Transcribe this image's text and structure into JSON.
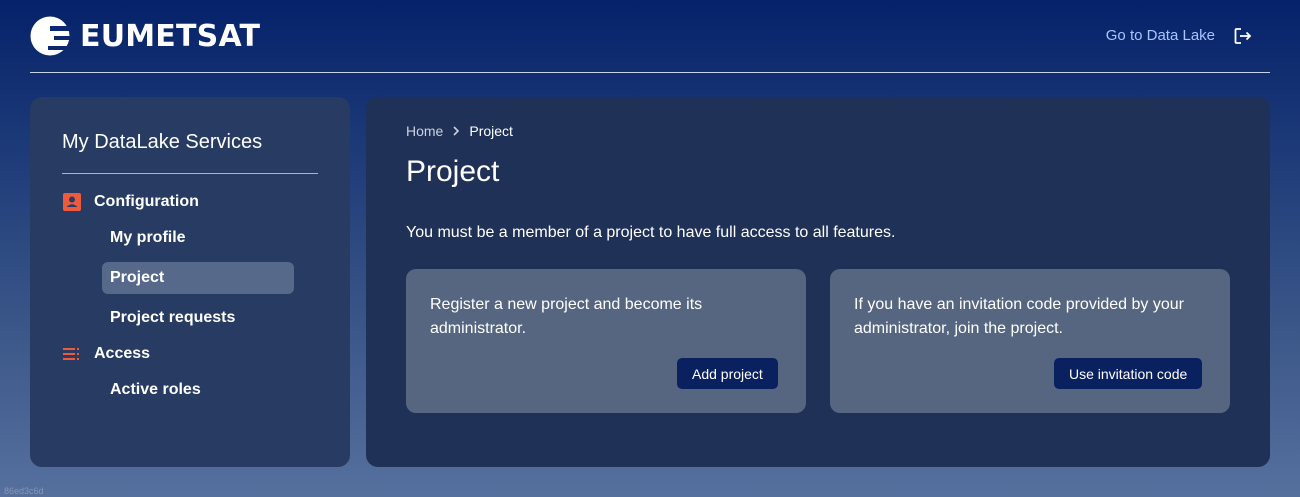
{
  "header": {
    "logo_text": "EUMETSAT",
    "data_lake_link": "Go to Data Lake",
    "logout_icon": "logout-icon"
  },
  "sidebar": {
    "title": "My DataLake Services",
    "sections": [
      {
        "label": "Configuration",
        "icon": "account-box-icon",
        "icon_color": "#f05a3c",
        "items": [
          {
            "label": "My profile",
            "active": false
          },
          {
            "label": "Project",
            "active": true
          },
          {
            "label": "Project requests",
            "active": false
          }
        ]
      },
      {
        "label": "Access",
        "icon": "list-icon",
        "icon_color": "#f05a3c",
        "items": [
          {
            "label": "Active roles",
            "active": false
          }
        ]
      }
    ]
  },
  "main": {
    "breadcrumb": {
      "home": "Home",
      "current": "Project"
    },
    "title": "Project",
    "intro": "You must be a member of a project to have full access to all features.",
    "cards": [
      {
        "text": "Register a new project and become its administrator.",
        "button": "Add project"
      },
      {
        "text": "If you have an invitation code provided by your administrator, join the project.",
        "button": "Use invitation code"
      }
    ]
  },
  "footer": {
    "version": "86ed3c6d"
  },
  "colors": {
    "accent": "#f05a3c",
    "button": "#0a2160",
    "link": "#a9c4ff",
    "active_nav": "#56698a"
  }
}
